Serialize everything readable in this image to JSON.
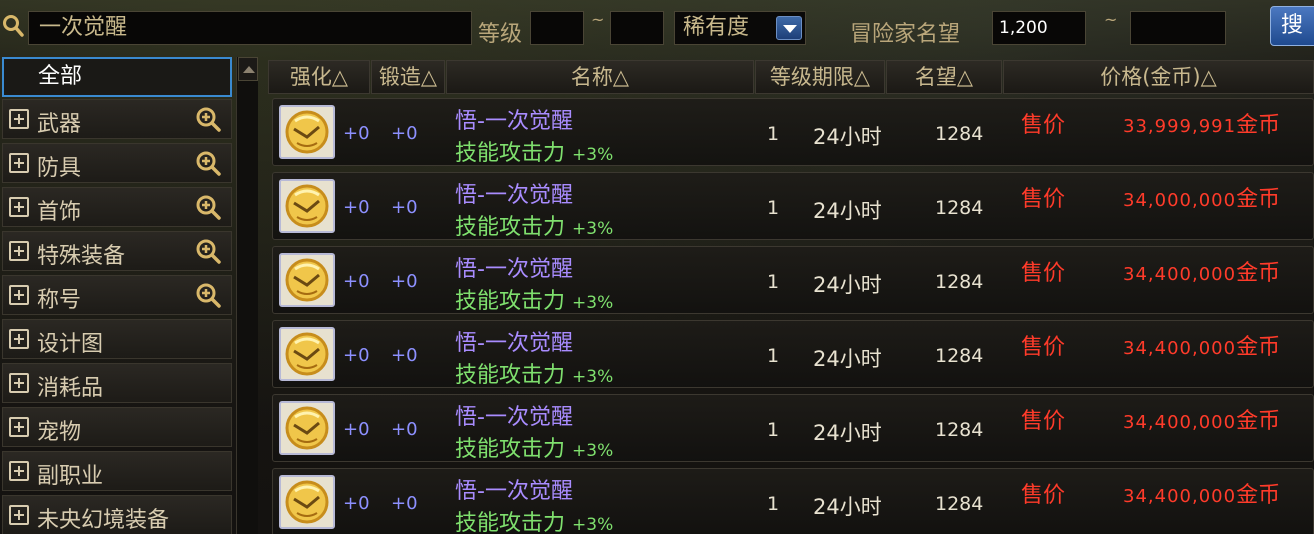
{
  "search": {
    "value": "一次觉醒",
    "level_label": "等级",
    "level_from": "",
    "level_to": "",
    "tilde": "~",
    "rarity_selected": "稀有度",
    "reputation_label": "冒险家名望",
    "reputation_from": "1,200",
    "reputation_to": "",
    "button_label": "搜"
  },
  "sidebar": {
    "items": [
      {
        "label": "全部",
        "selected": true
      },
      {
        "label": "武器",
        "zoom": true
      },
      {
        "label": "防具",
        "zoom": true
      },
      {
        "label": "首饰",
        "zoom": true
      },
      {
        "label": "特殊装备",
        "zoom": true
      },
      {
        "label": "称号",
        "zoom": true
      },
      {
        "label": "设计图",
        "zoom": false
      },
      {
        "label": "消耗品",
        "zoom": false
      },
      {
        "label": "宠物",
        "zoom": false
      },
      {
        "label": "副职业",
        "zoom": false
      },
      {
        "label": "未央幻境装备",
        "zoom": false
      }
    ]
  },
  "table": {
    "headers": {
      "enhance": "强化△",
      "forge": "锻造△",
      "name": "名称△",
      "level_time": "等级期限△",
      "reputation": "名望△",
      "price": "价格(金币)△"
    },
    "rows": [
      {
        "enhance": "+0",
        "forge": "+0",
        "name": "悟-一次觉醒",
        "stat": "技能攻击力",
        "stat_value": "+3%",
        "level": "1",
        "duration": "24小时",
        "reputation": "1284",
        "sell": "售价",
        "price": "33,999,991",
        "unit": "金币"
      },
      {
        "enhance": "+0",
        "forge": "+0",
        "name": "悟-一次觉醒",
        "stat": "技能攻击力",
        "stat_value": "+3%",
        "level": "1",
        "duration": "24小时",
        "reputation": "1284",
        "sell": "售价",
        "price": "34,000,000",
        "unit": "金币"
      },
      {
        "enhance": "+0",
        "forge": "+0",
        "name": "悟-一次觉醒",
        "stat": "技能攻击力",
        "stat_value": "+3%",
        "level": "1",
        "duration": "24小时",
        "reputation": "1284",
        "sell": "售价",
        "price": "34,400,000",
        "unit": "金币"
      },
      {
        "enhance": "+0",
        "forge": "+0",
        "name": "悟-一次觉醒",
        "stat": "技能攻击力",
        "stat_value": "+3%",
        "level": "1",
        "duration": "24小时",
        "reputation": "1284",
        "sell": "售价",
        "price": "34,400,000",
        "unit": "金币"
      },
      {
        "enhance": "+0",
        "forge": "+0",
        "name": "悟-一次觉醒",
        "stat": "技能攻击力",
        "stat_value": "+3%",
        "level": "1",
        "duration": "24小时",
        "reputation": "1284",
        "sell": "售价",
        "price": "34,400,000",
        "unit": "金币"
      },
      {
        "enhance": "+0",
        "forge": "+0",
        "name": "悟-一次觉醒",
        "stat": "技能攻击力",
        "stat_value": "+3%",
        "level": "1",
        "duration": "24小时",
        "reputation": "1284",
        "sell": "售价",
        "price": "34,400,000",
        "unit": "金币"
      }
    ]
  },
  "colors": {
    "item_name": "#a98cff",
    "stat": "#7fe06e",
    "price": "#ff3b2a",
    "enhance": "#8d90ff",
    "selected_border": "#3a8ad0"
  }
}
